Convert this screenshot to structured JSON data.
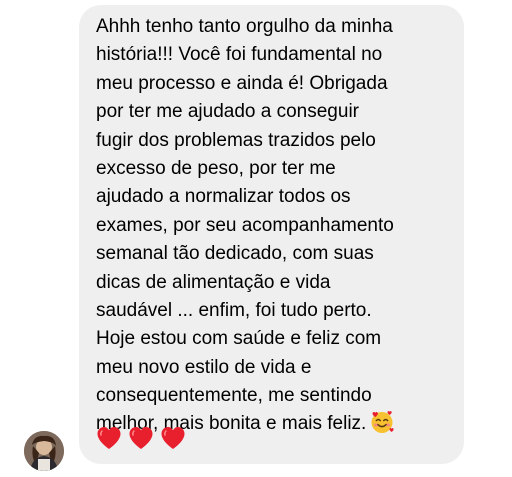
{
  "message": {
    "lines": [
      "Ahhh tenho tanto orgulho da minha",
      "história!!! Você foi fundamental no",
      "meu processo e ainda é! Obrigada",
      "por ter me ajudado a conseguir",
      "fugir dos problemas trazidos pelo",
      "excesso de peso, por ter me",
      "ajudado a normalizar todos os",
      "exames, por seu acompanhamento",
      "semanal tão dedicado, com suas",
      "dicas de alimentação e vida",
      "saudável ... enfim, foi tudo perto.",
      "Hoje estou com saúde e feliz com",
      "meu novo estilo de vida e",
      "consequentemente, me sentindo",
      "melhor, mais bonita e mais feliz."
    ],
    "emojis": [
      "smiling-face-with-hearts-icon",
      "red-heart-icon",
      "red-heart-icon",
      "red-heart-icon"
    ]
  },
  "colors": {
    "bubble": "#efefef",
    "text": "#000000",
    "heart": "#e8202e",
    "emoji_face": "#f7c130"
  }
}
